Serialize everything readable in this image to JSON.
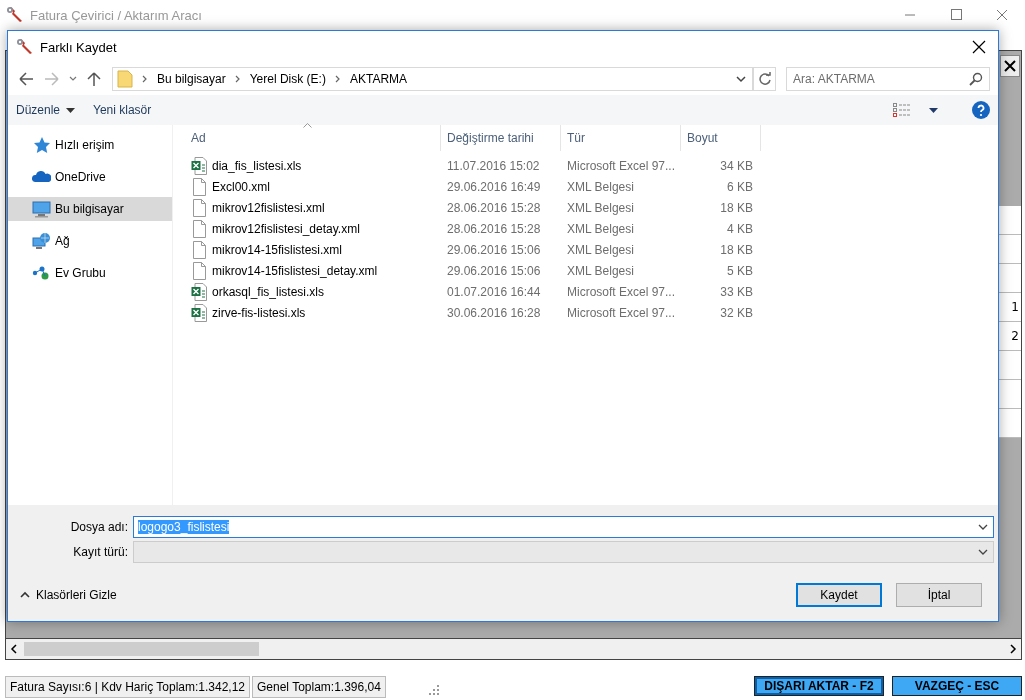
{
  "app": {
    "title": "Fatura Çevirici / Aktarım Aracı",
    "status_bar": [
      "Fatura Sayısı:6 | Kdv Hariç Toplam:1.342,12",
      "Genel Toplam:1.396,04"
    ],
    "grid_values": [
      "1",
      "2"
    ],
    "actions": [
      {
        "label": "DIŞARI AKTAR - F2",
        "focused": true
      },
      {
        "label": "VAZGEÇ - ESC",
        "focused": false
      }
    ]
  },
  "dialog": {
    "title": "Farklı Kaydet",
    "breadcrumbs": [
      "Bu bilgisayar",
      "Yerel Disk (E:)",
      "AKTARMA"
    ],
    "search": {
      "placeholder": "Ara: AKTARMA"
    },
    "toolbar": [
      {
        "label": "Düzenle",
        "kind": "menu"
      },
      {
        "label": "Yeni klasör",
        "kind": "button"
      }
    ],
    "nav": [
      {
        "label": "Hızlı erişim",
        "kind": "quick",
        "selected": false
      },
      {
        "label": "OneDrive",
        "kind": "cloud",
        "selected": false
      },
      {
        "label": "Bu bilgisayar",
        "kind": "pc",
        "selected": true
      },
      {
        "label": "Ağ",
        "kind": "network",
        "selected": false
      },
      {
        "label": "Ev Grubu",
        "kind": "homegroup",
        "selected": false
      }
    ],
    "columns": [
      {
        "label": "Ad",
        "sorted": true
      },
      {
        "label": "Değiştirme tarihi",
        "sorted": false
      },
      {
        "label": "Tür",
        "sorted": false
      },
      {
        "label": "Boyut",
        "sorted": false
      }
    ],
    "files": [
      {
        "name": "dia_fis_listesi.xls",
        "kind": "excel",
        "modified": "11.07.2016 15:02",
        "type": "Microsoft Excel 97...",
        "size": "34 KB"
      },
      {
        "name": "Excl00.xml",
        "kind": "file",
        "modified": "29.06.2016 16:49",
        "type": "XML Belgesi",
        "size": "6 KB"
      },
      {
        "name": "mikrov12fislistesi.xml",
        "kind": "file",
        "modified": "28.06.2016 15:28",
        "type": "XML Belgesi",
        "size": "18 KB"
      },
      {
        "name": "mikrov12fislistesi_detay.xml",
        "kind": "file",
        "modified": "28.06.2016 15:28",
        "type": "XML Belgesi",
        "size": "4 KB"
      },
      {
        "name": "mikrov14-15fislistesi.xml",
        "kind": "file",
        "modified": "29.06.2016 15:06",
        "type": "XML Belgesi",
        "size": "18 KB"
      },
      {
        "name": "mikrov14-15fislistesi_detay.xml",
        "kind": "file",
        "modified": "29.06.2016 15:06",
        "type": "XML Belgesi",
        "size": "5 KB"
      },
      {
        "name": "orkasql_fis_listesi.xls",
        "kind": "excel",
        "modified": "01.07.2016 16:44",
        "type": "Microsoft Excel 97...",
        "size": "33 KB"
      },
      {
        "name": "zirve-fis-listesi.xls",
        "kind": "excel",
        "modified": "30.06.2016 16:28",
        "type": "Microsoft Excel 97...",
        "size": "32 KB"
      }
    ],
    "file_name": {
      "label": "Dosya adı:",
      "value": "logogo3_fislistesi",
      "selected": true
    },
    "file_type": {
      "label": "Kayıt türü:",
      "disabled": true
    },
    "folders_toggle": {
      "label": "Klasörleri Gizle",
      "expanded": true
    },
    "buttons": [
      {
        "label": "Kaydet",
        "default": true
      },
      {
        "label": "İptal",
        "default": false
      }
    ]
  }
}
